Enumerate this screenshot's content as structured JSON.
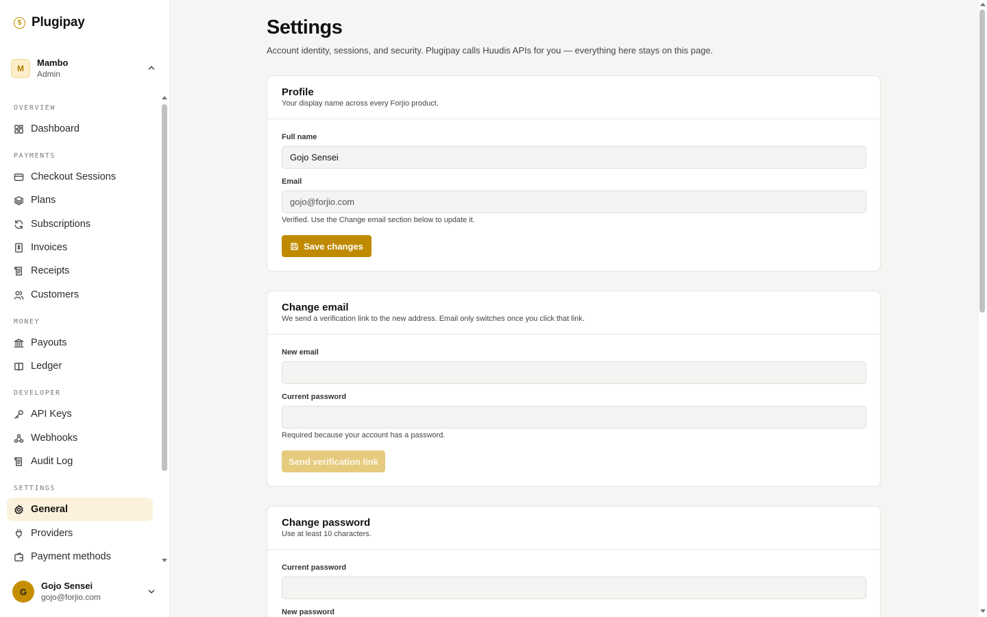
{
  "brand": {
    "name": "Plugipay",
    "logo_glyph": "$",
    "accent_color": "#c08a00"
  },
  "workspace": {
    "initial": "M",
    "name": "Mambo",
    "role": "Admin"
  },
  "nav": {
    "sections": [
      {
        "label": "OVERVIEW"
      },
      {
        "label": "PAYMENTS"
      },
      {
        "label": "MONEY"
      },
      {
        "label": "DEVELOPER"
      },
      {
        "label": "SETTINGS"
      }
    ],
    "items": [
      {
        "label": "Dashboard",
        "icon": "dashboard-icon"
      },
      {
        "label": "Checkout Sessions",
        "icon": "credit-card-icon"
      },
      {
        "label": "Plans",
        "icon": "layers-icon"
      },
      {
        "label": "Subscriptions",
        "icon": "refresh-icon"
      },
      {
        "label": "Invoices",
        "icon": "invoice-icon"
      },
      {
        "label": "Receipts",
        "icon": "receipt-icon"
      },
      {
        "label": "Customers",
        "icon": "users-icon"
      },
      {
        "label": "Payouts",
        "icon": "bank-icon"
      },
      {
        "label": "Ledger",
        "icon": "book-icon"
      },
      {
        "label": "API Keys",
        "icon": "key-icon"
      },
      {
        "label": "Webhooks",
        "icon": "webhook-icon"
      },
      {
        "label": "Audit Log",
        "icon": "scroll-icon"
      },
      {
        "label": "General",
        "icon": "gear-icon",
        "active": true
      },
      {
        "label": "Providers",
        "icon": "plug-icon"
      },
      {
        "label": "Payment methods",
        "icon": "wallet-icon"
      }
    ]
  },
  "user": {
    "initial": "G",
    "name": "Gojo Sensei",
    "email": "gojo@forjio.com"
  },
  "page": {
    "title": "Settings",
    "subtitle": "Account identity, sessions, and security. Plugipay calls Huudis APIs for you — everything here stays on this page."
  },
  "profile": {
    "title": "Profile",
    "desc": "Your display name across every Forjio product.",
    "full_name_label": "Full name",
    "full_name_value": "Gojo Sensei",
    "email_label": "Email",
    "email_value": "gojo@forjio.com",
    "email_hint": "Verified. Use the Change email section below to update it.",
    "save_label": "Save changes"
  },
  "change_email": {
    "title": "Change email",
    "desc": "We send a verification link to the new address. Email only switches once you click that link.",
    "new_email_label": "New email",
    "new_email_value": "",
    "current_password_label": "Current password",
    "current_password_value": "",
    "hint": "Required because your account has a password.",
    "submit_label": "Send verification link"
  },
  "change_password": {
    "title": "Change password",
    "desc": "Use at least 10 characters.",
    "current_password_label": "Current password",
    "current_password_value": "",
    "new_password_label": "New password"
  }
}
